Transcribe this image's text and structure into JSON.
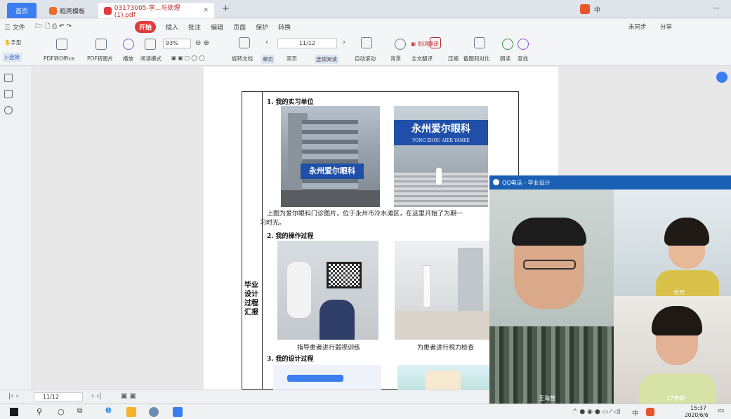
{
  "tabs": {
    "home": "首页",
    "templates": "稻壳模板",
    "doc": "03173005-李...与处理(1).pdf",
    "new_tab": "+"
  },
  "menu": {
    "file": "三 文件",
    "items": [
      "开始",
      "插入",
      "批注",
      "编辑",
      "页面",
      "保护",
      "转换"
    ],
    "sync": "未同步",
    "share": "分享"
  },
  "toolbar": {
    "hand": "手型",
    "select": "选择",
    "pdf_office": "PDF转Office",
    "pdf_img": "PDF转图片",
    "play": "播放",
    "read_mode": "阅读模式",
    "zoom": "93%",
    "page_input": "11/12",
    "rotate": "旋转文档",
    "single": "单页",
    "double": "双页",
    "continuous": "连续阅读",
    "auto_scroll": "自动滚动",
    "background": "背景",
    "translate_word": "划词翻译",
    "full_translate": "全文翻译",
    "compress": "压缩",
    "compare": "截图和对比",
    "read_aloud": "朗读",
    "find": "查找"
  },
  "doc": {
    "side_title": "毕业设计过程汇报",
    "sec1": "1. 我的实习单位",
    "sign_text": "永州爱尔眼科",
    "sign_sub": "YONG ZHOU AIER YANKE",
    "para1_line1": "上图为爱尔眼科门诊图片，位于永州市冷水滩区，在这里开始了为期一",
    "para1_line2": "习时光。",
    "sec2": "2. 我的操作过程",
    "cap1": "指导患者进行弱视训练",
    "cap2": "为患者进行视力检查",
    "sec3": "3. 我的设计过程"
  },
  "qq": {
    "title": "QQ电话 - 毕业设计",
    "caller1": "王海营",
    "caller2": "元元",
    "caller3": "17李娜"
  },
  "bottom": {
    "page_input": "11/12"
  },
  "taskbar": {
    "time": "15:37",
    "date": "2020/6/6",
    "ime": "中"
  }
}
